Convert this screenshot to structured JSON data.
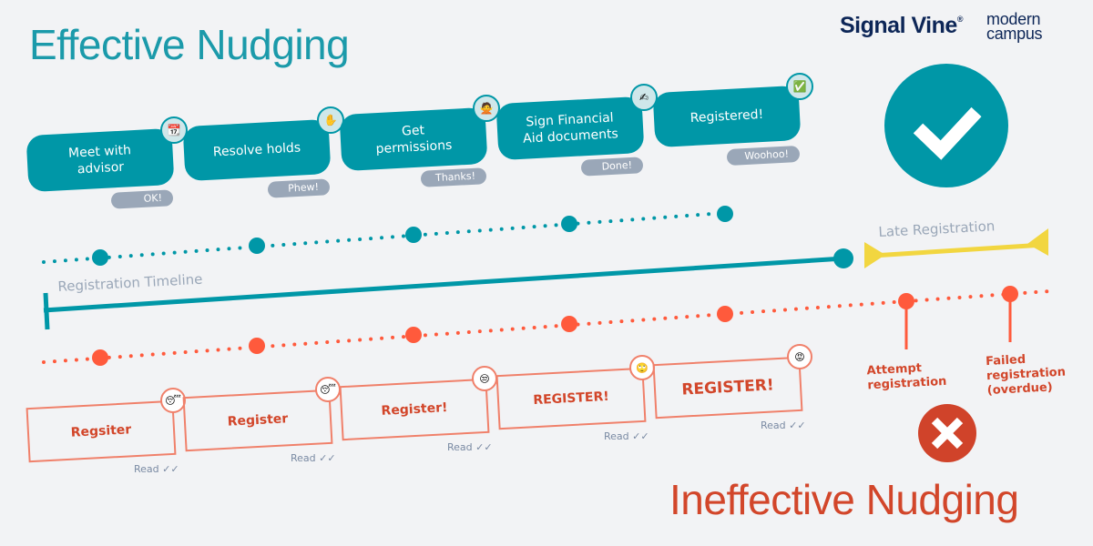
{
  "header": {
    "title_effective": "Effective Nudging",
    "title_ineffective": "Ineffective Nudging",
    "logo_signal_vine": "Signal Vine",
    "logo_signal_vine_mark": "®",
    "logo_modern": "modern",
    "logo_campus": "campus"
  },
  "colors": {
    "effective": "#0097a7",
    "ineffective": "#d2462a",
    "ineffective_dot": "#ff5a3c",
    "late_registration": "#f2d640",
    "muted": "#9aa7b8",
    "background": "#f2f3f5"
  },
  "effective": {
    "steps": [
      {
        "label": "Meet with advisor",
        "icon": "calendar-icon",
        "emoji": "📆",
        "reply": "OK!"
      },
      {
        "label": "Resolve holds",
        "icon": "raised-hand-icon",
        "emoji": "✋",
        "reply": "Phew!"
      },
      {
        "label": "Get permissions",
        "icon": "person-gesturing-no-icon",
        "emoji": "🙅",
        "reply": "Thanks!"
      },
      {
        "label": "Sign Financial Aid documents",
        "icon": "writing-hand-icon",
        "emoji": "✍",
        "reply": "Done!"
      },
      {
        "label": "Registered!",
        "icon": "check-mark-button-icon",
        "emoji": "✅",
        "reply": "Woohoo!"
      }
    ],
    "outcome_icon": "check-circle-icon"
  },
  "timeline": {
    "label": "Registration Timeline",
    "late_label": "Late Registration"
  },
  "ineffective": {
    "messages": [
      {
        "label": "Regsiter",
        "emoji": "😴",
        "icon": "sleeping-face-icon",
        "status": "Read"
      },
      {
        "label": "Register",
        "emoji": "😴",
        "icon": "sleeping-face-icon",
        "status": "Read"
      },
      {
        "label": "Register!",
        "emoji": "😒",
        "icon": "unamused-face-icon",
        "status": "Read"
      },
      {
        "label": "REGISTER!",
        "emoji": "🙄",
        "icon": "rolling-eyes-face-icon",
        "status": "Read"
      },
      {
        "label": "REGISTER!",
        "emoji": "😡",
        "icon": "angry-face-icon",
        "status": "Read"
      }
    ],
    "events": [
      {
        "label": "Attempt registration"
      },
      {
        "label": "Failed registration (overdue)"
      }
    ],
    "outcome_icon": "x-circle-icon"
  }
}
